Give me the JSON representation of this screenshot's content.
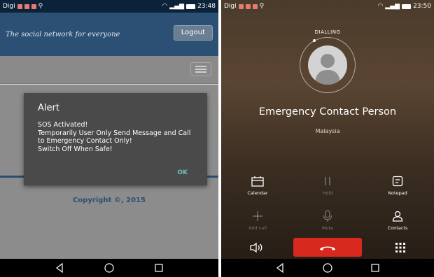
{
  "left": {
    "status": {
      "carrier": "Digi",
      "time": "23:48"
    },
    "header": {
      "tagline": "The social network for everyone",
      "logout_label": "Logout"
    },
    "alert": {
      "title": "Alert",
      "message": "SOS Activated!\nTemporarily User Only Send Message and Call to Emergency Contact Only!\nSwitch Off When Safe!",
      "ok_label": "OK"
    },
    "footer": {
      "copyright": "Copyright ©, 2015"
    }
  },
  "right": {
    "status": {
      "carrier": "Digi",
      "time": "23:50"
    },
    "call": {
      "state": "DIALLING",
      "contact_name": "Emergency Contact Person",
      "country": "Malaysia"
    },
    "actions": [
      {
        "label": "Calendar",
        "icon": "calendar-icon",
        "enabled": true
      },
      {
        "label": "Hold",
        "icon": "pause-icon",
        "enabled": false
      },
      {
        "label": "Notepad",
        "icon": "notepad-icon",
        "enabled": true
      },
      {
        "label": "Add call",
        "icon": "plus-icon",
        "enabled": false
      },
      {
        "label": "Mute",
        "icon": "microphone-icon",
        "enabled": false
      },
      {
        "label": "Contacts",
        "icon": "person-icon",
        "enabled": true
      }
    ],
    "colors": {
      "end_call": "#d8291f"
    }
  },
  "colors": {
    "header_blue": "#2c4f74",
    "dialog_ok": "#6ec2b6"
  }
}
